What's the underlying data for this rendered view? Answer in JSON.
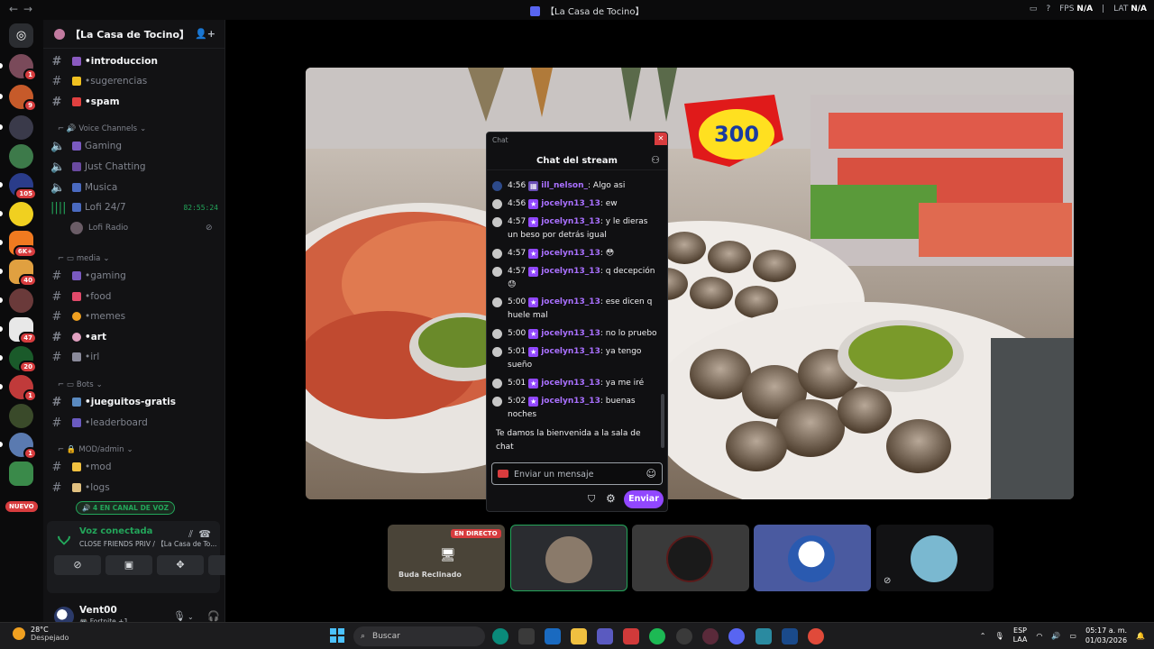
{
  "window": {
    "title": "【La Casa de Tocino】",
    "fps_label": "FPS",
    "fps_value": "N/A",
    "lat_label": "LAT",
    "lat_value": "N/A"
  },
  "rail": {
    "badges": [
      "1",
      "9",
      "",
      "",
      "105",
      "",
      "6K+",
      "40",
      "",
      "47",
      "20",
      "1",
      "",
      "1"
    ],
    "nuevo_label": "NUEVO"
  },
  "guild": {
    "name": "【La Casa de Tocino】"
  },
  "channels": [
    {
      "name": "introduccion",
      "unread": true
    },
    {
      "name": "sugerencias",
      "unread": false
    },
    {
      "name": "spam",
      "unread": true
    }
  ],
  "voice_category": "Voice Channels",
  "voice_channels": [
    {
      "name": "Gaming"
    },
    {
      "name": "Just Chatting"
    },
    {
      "name": "Musica"
    },
    {
      "name": "Lofi 24/7",
      "time": "82:55:24"
    }
  ],
  "voice_user": "Lofi Radio",
  "media_category": "media",
  "media_channels": [
    {
      "name": "gaming",
      "unread": false
    },
    {
      "name": "food",
      "unread": false
    },
    {
      "name": "memes",
      "unread": false
    },
    {
      "name": "art",
      "unread": true
    },
    {
      "name": "irl",
      "unread": false
    }
  ],
  "bots_category": "Bots",
  "bots_channels": [
    {
      "name": "jueguitos-gratis",
      "unread": true
    },
    {
      "name": "leaderboard",
      "unread": false
    }
  ],
  "mod_category": "MOD/admin",
  "mod_channels": [
    {
      "name": "mod",
      "unread": false
    },
    {
      "name": "logs",
      "unread": false
    }
  ],
  "voice_pill": "4 EN CANAL DE VOZ",
  "voice_panel": {
    "status": "Voz conectada",
    "location": "CLOSE FRIENDS PRIV / 【La Casa de To..."
  },
  "user": {
    "name": "Vent00",
    "activity": "Fortnite +1"
  },
  "chat": {
    "popout_title": "Chat",
    "header": "Chat del stream",
    "messages": [
      {
        "time": "4:56",
        "user": "ill_nelson_",
        "text": ": Algo asi"
      },
      {
        "time": "4:56",
        "user": "jocelyn13_13",
        "text": ": ew"
      },
      {
        "time": "4:57",
        "user": "jocelyn13_13",
        "text": ": y le dieras un beso por detrás igual"
      },
      {
        "time": "4:57",
        "user": "jocelyn13_13",
        "text": ": 😳"
      },
      {
        "time": "4:57",
        "user": "jocelyn13_13",
        "text": ": q decepción 😓"
      },
      {
        "time": "5:00",
        "user": "jocelyn13_13",
        "text": ": ese dicen q huele mal"
      },
      {
        "time": "5:00",
        "user": "jocelyn13_13",
        "text": ": no lo pruebo"
      },
      {
        "time": "5:01",
        "user": "jocelyn13_13",
        "text": ": ya tengo sueño"
      },
      {
        "time": "5:01",
        "user": "jocelyn13_13",
        "text": ": ya me iré"
      },
      {
        "time": "5:02",
        "user": "jocelyn13_13",
        "text": ": buenas noches"
      }
    ],
    "welcome": "Te damos la bienvenida a la sala de chat",
    "input_placeholder": "Enviar un mensaje",
    "send_label": "Enviar"
  },
  "tiles": {
    "live_label": "EN DIRECTO",
    "stream_name": "Buda Reclinado"
  },
  "taskbar": {
    "temperature": "28°C",
    "weather": "Despejado",
    "search_label": "Buscar",
    "lang_1": "ESP",
    "lang_2": "LAA",
    "time": "05:17 a. m.",
    "date": "01/03/2026"
  }
}
